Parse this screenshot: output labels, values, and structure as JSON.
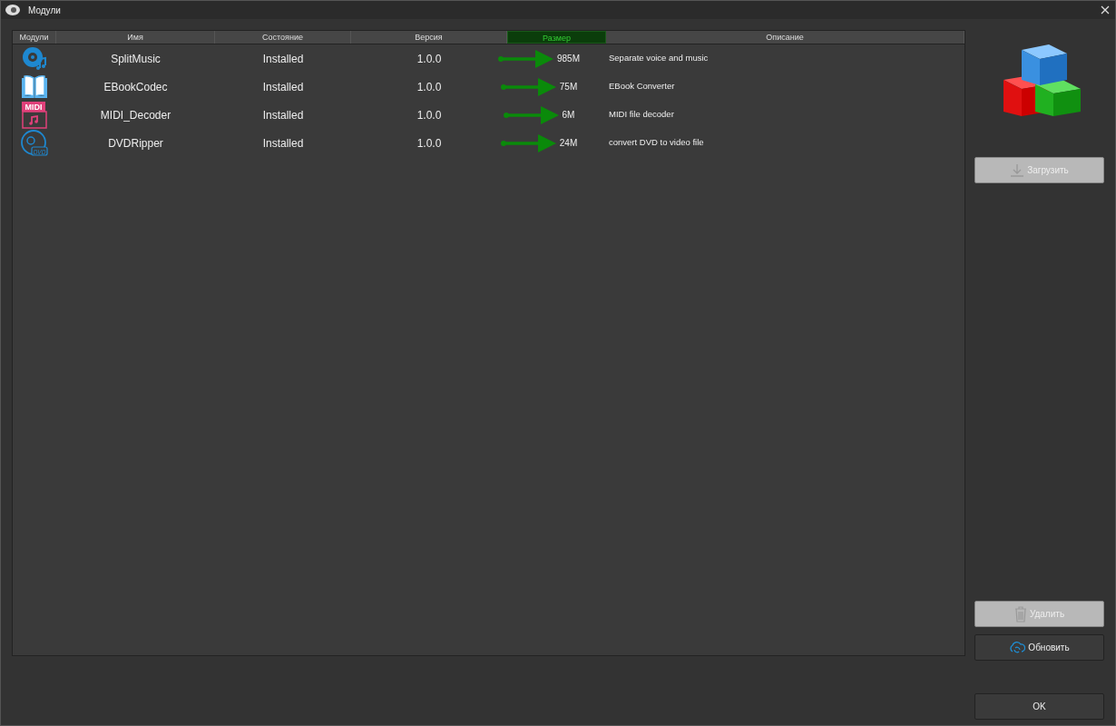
{
  "window": {
    "title": "Модули"
  },
  "table": {
    "columns": [
      {
        "label": "Модули",
        "selected": false
      },
      {
        "label": "Имя",
        "selected": false
      },
      {
        "label": "Состояние",
        "selected": false
      },
      {
        "label": "Версия",
        "selected": false
      },
      {
        "label": "Размер",
        "selected": true
      },
      {
        "label": "Описание",
        "selected": false
      }
    ],
    "rows": [
      {
        "kind": "music",
        "name": "SplitMusic",
        "state": "Installed",
        "version": "1.0.0",
        "size": "985M",
        "description": "Separate voice and music"
      },
      {
        "kind": "book",
        "name": "EBookCodec",
        "state": "Installed",
        "version": "1.0.0",
        "size": "75M",
        "description": "EBook Converter"
      },
      {
        "kind": "midi",
        "name": "MIDI_Decoder",
        "state": "Installed",
        "version": "1.0.0",
        "size": "6M",
        "description": "MIDI file decoder",
        "icon_text": "MIDI"
      },
      {
        "kind": "dvd",
        "name": "DVDRipper",
        "state": "Installed",
        "version": "1.0.0",
        "size": "24M",
        "description": "convert DVD to video file",
        "icon_text": "DVD"
      }
    ]
  },
  "buttons": [
    {
      "kind": "download",
      "label": "Загрузить",
      "disabled": true
    },
    {
      "kind": "delete",
      "label": "Удалить",
      "disabled": true
    },
    {
      "kind": "refresh",
      "label": "Обновить",
      "disabled": false
    },
    {
      "kind": "ok",
      "label": "OK",
      "disabled": false
    }
  ]
}
